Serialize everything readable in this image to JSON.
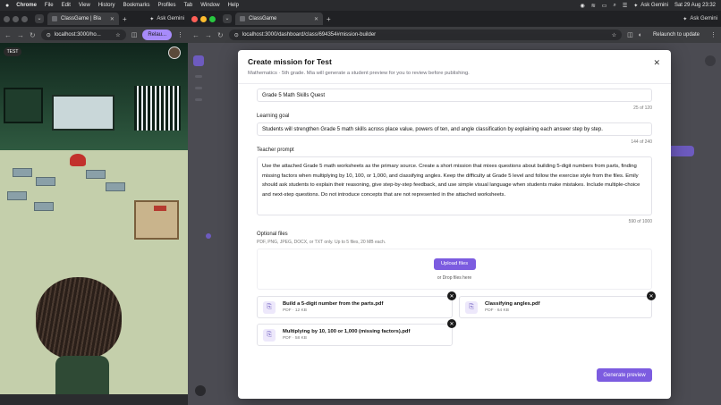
{
  "menubar": {
    "app": "Chrome",
    "items": [
      "File",
      "Edit",
      "View",
      "History",
      "Bookmarks",
      "Profiles",
      "Tab",
      "Window",
      "Help"
    ],
    "ask_gemini": "Ask Gemini",
    "datetime": "Sat 29 Aug  23:32"
  },
  "left_window": {
    "tab_title": "ClassGame | Bla",
    "ask_gemini": "Ask Gemini",
    "url": "localhost:3000/ho...",
    "relaunch": "Relau...",
    "badge": "TEST"
  },
  "right_window": {
    "tab_title": "ClassGame",
    "url": "localhost:3000/dashboard/class/694354#mission-builder",
    "relaunch": "Relaunch to update"
  },
  "modal": {
    "title": "Create mission for Test",
    "subtitle": "Mathematics · 5th grade. Mia will generate a student preview for you to review before publishing.",
    "title_field": {
      "value": "Grade 5 Math Skills Quest",
      "counter": "25 of 120"
    },
    "goal": {
      "label": "Learning goal",
      "value": "Students will strengthen Grade 5 math skills across place value, powers of ten, and angle classification by explaining each answer step by step.",
      "counter": "144 of 240"
    },
    "prompt": {
      "label": "Teacher prompt",
      "value": "Use the attached Grade 5 math worksheets as the primary source. Create a short mission that mixes questions about building 5-digit numbers from parts, finding missing factors when multiplying by 10, 100, or 1,000, and classifying angles. Keep the difficulty at Grade 5 level and follow the exercise style from the files. Emily should ask students to explain their reasoning, give step-by-step feedback, and use simple visual language when students make mistakes. Include multiple-choice and next-step questions. Do not introduce concepts that are not represented in the attached worksheets.",
      "counter": "590 of 1000"
    },
    "files": {
      "label": "Optional files",
      "help": "PDF, PNG, JPEG, DOCX, or TXT only. Up to 5 files, 20 MB each.",
      "upload_button": "Upload files",
      "drop_text": "or Drop files here",
      "items": [
        {
          "name": "Build a 5-digit number from the parts.pdf",
          "meta": "PDF · 12 KB"
        },
        {
          "name": "Classifying angles.pdf",
          "meta": "PDF · 64 KB"
        },
        {
          "name": "Multiplying by 10, 100 or 1,000 (missing factors).pdf",
          "meta": "PDF · 58 KB"
        }
      ]
    },
    "generate_button": "Generate preview"
  }
}
